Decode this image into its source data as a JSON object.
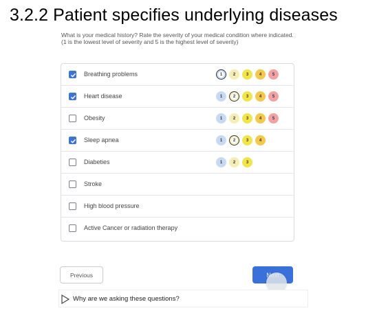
{
  "page_title": "3.2.2 Patient specifies underlying diseases",
  "question": "What is your medical history? Rate the severity of your medical condition where indicated. (1 is the lowest level of severity and 5 is the highest level of severity)",
  "conditions": [
    {
      "label": "Breathing problems",
      "checked": true,
      "levels": [
        "1",
        "2",
        "3",
        "4",
        "5"
      ],
      "selected": "1"
    },
    {
      "label": "Heart disease",
      "checked": true,
      "levels": [
        "1",
        "2",
        "3",
        "4",
        "5"
      ],
      "selected": "2"
    },
    {
      "label": "Obesity",
      "checked": false,
      "levels": [
        "1",
        "2",
        "3",
        "4",
        "5"
      ],
      "selected": null
    },
    {
      "label": "Sleep apnea",
      "checked": true,
      "levels": [
        "1",
        "2",
        "3",
        "4"
      ],
      "selected": "2"
    },
    {
      "label": "Diabeties",
      "checked": false,
      "levels": [
        "1",
        "2",
        "3"
      ],
      "selected": null
    },
    {
      "label": "Stroke",
      "checked": false,
      "levels": [],
      "selected": null
    },
    {
      "label": "High blood pressure",
      "checked": false,
      "levels": [],
      "selected": null
    },
    {
      "label": "Active Cancer or radiation therapy",
      "checked": false,
      "levels": [],
      "selected": null
    }
  ],
  "buttons": {
    "previous": "Previous",
    "next": "Next"
  },
  "help": {
    "text": "Why are we asking these questions?",
    "icon": "play-triangle-icon"
  },
  "colors": {
    "accent": "#3a70d9",
    "level_1": "#c8daf2",
    "level_2": "#f5efb7",
    "level_3": "#f2e54a",
    "level_4": "#f4c84c",
    "level_5": "#f3a2a2"
  }
}
